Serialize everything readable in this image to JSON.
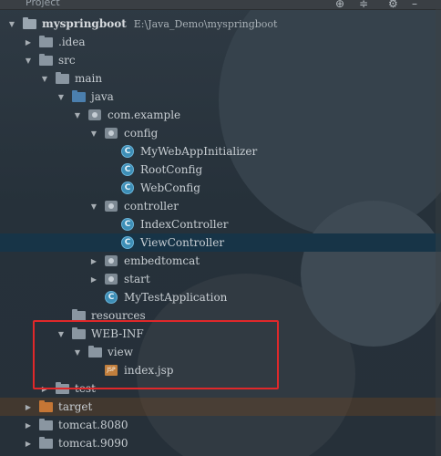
{
  "toolbar": {
    "title": "Project",
    "icons": [
      "target-icon",
      "collapse-icon",
      "gear-icon",
      "minimize-icon"
    ]
  },
  "tree": [
    {
      "label": "myspringboot",
      "path": "E:\\Java_Demo\\myspringboot",
      "icon": "folder",
      "expanded": true,
      "bold": true
    },
    {
      "label": ".idea",
      "icon": "folder",
      "expanded": false
    },
    {
      "label": "src",
      "icon": "folder",
      "expanded": true
    },
    {
      "label": "main",
      "icon": "folder",
      "expanded": true
    },
    {
      "label": "java",
      "icon": "folder-blue",
      "expanded": true
    },
    {
      "label": "com.example",
      "icon": "package",
      "expanded": true
    },
    {
      "label": "config",
      "icon": "package",
      "expanded": true
    },
    {
      "label": "MyWebAppInitializer",
      "icon": "class"
    },
    {
      "label": "RootConfig",
      "icon": "class"
    },
    {
      "label": "WebConfig",
      "icon": "class"
    },
    {
      "label": "controller",
      "icon": "package",
      "expanded": true
    },
    {
      "label": "IndexController",
      "icon": "class"
    },
    {
      "label": "ViewController",
      "icon": "class",
      "selected": true
    },
    {
      "label": "embedtomcat",
      "icon": "package",
      "expanded": false
    },
    {
      "label": "start",
      "icon": "package",
      "expanded": false
    },
    {
      "label": "MyTestApplication",
      "icon": "class"
    },
    {
      "label": "resources",
      "icon": "folder"
    },
    {
      "label": "WEB-INF",
      "icon": "folder",
      "expanded": true
    },
    {
      "label": "view",
      "icon": "folder",
      "expanded": true
    },
    {
      "label": "index.jsp",
      "icon": "jsp"
    },
    {
      "label": "test",
      "icon": "folder",
      "expanded": false
    },
    {
      "label": "target",
      "icon": "folder-orange",
      "expanded": false
    },
    {
      "label": "tomcat.8080",
      "icon": "folder",
      "expanded": false
    },
    {
      "label": "tomcat.9090",
      "icon": "folder",
      "expanded": false
    }
  ],
  "colors": {
    "selection": "#173447",
    "highlight_box": "#e0282a",
    "class_icon": "#3d8eb6",
    "source_folder": "#4b7fae",
    "excluded_folder": "#c57635"
  }
}
